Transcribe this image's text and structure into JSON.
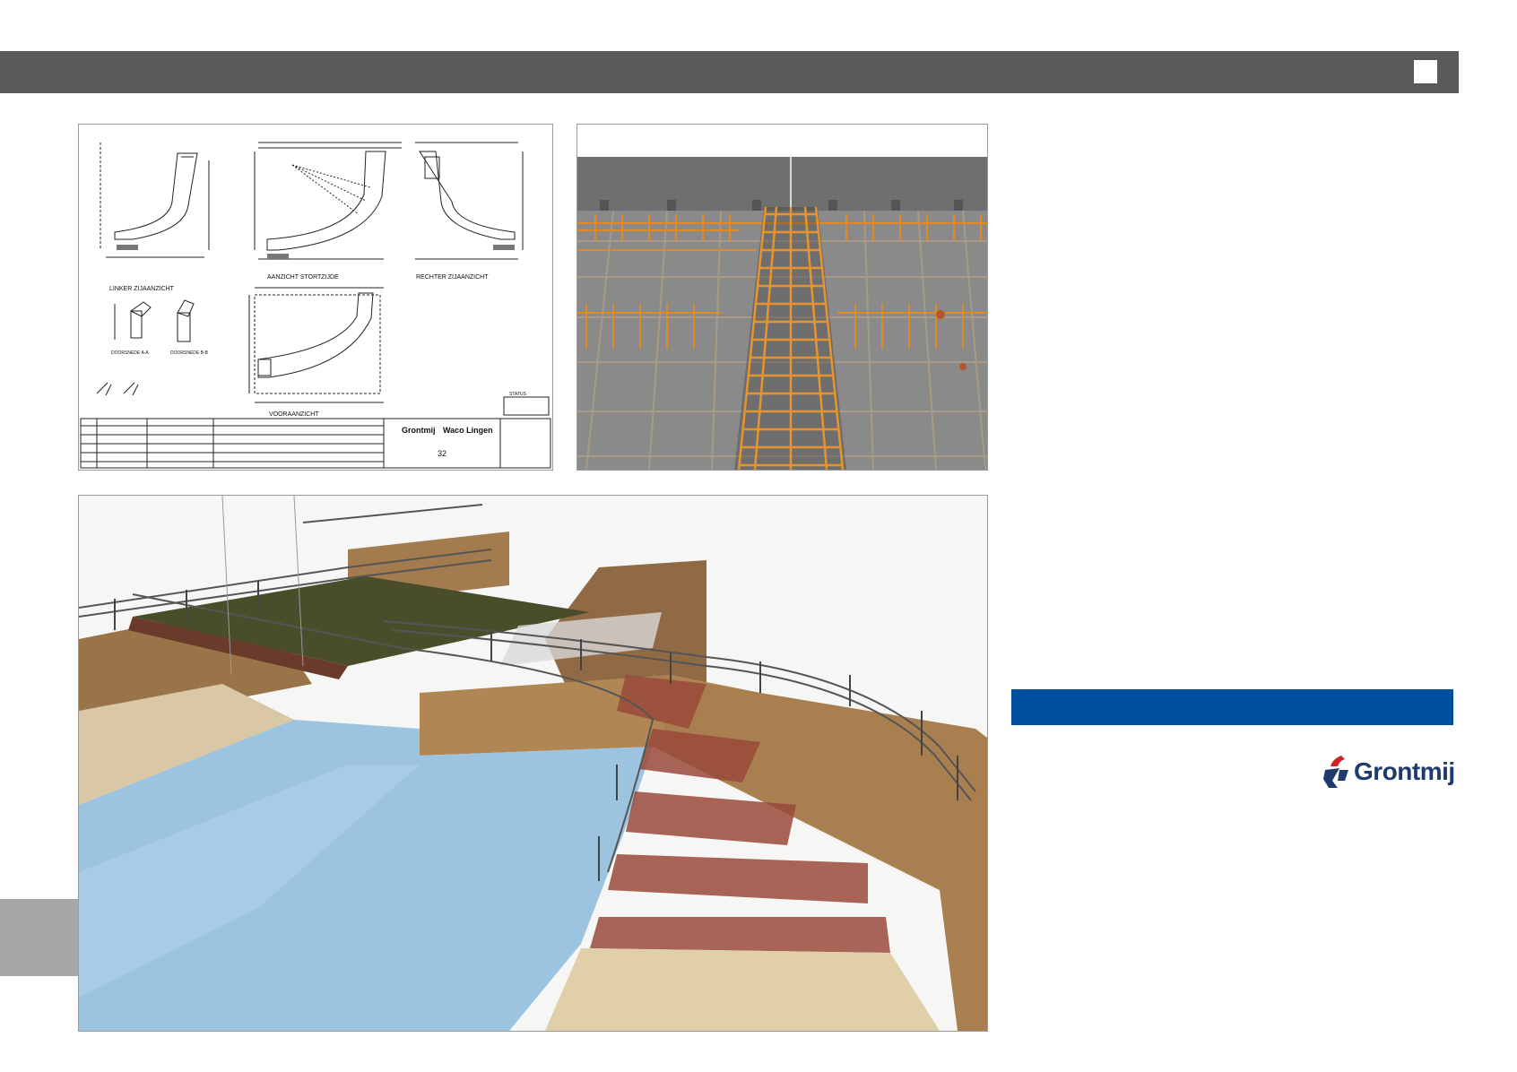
{
  "header": {
    "square_icon": "white-square"
  },
  "drawing": {
    "view_left": "LINKER ZIJAANZICHT",
    "view_front": "AANZICHT STORTZIJDE",
    "view_right": "RECHTER ZIJAANZICHT",
    "view_bottom": "VOORAANZICHT",
    "section_a": "DOORSNEDE A-A",
    "section_b": "DOORSNEDE B-B",
    "status_label": "STATUS",
    "titleblock_logo_1": "Grontmij",
    "titleblock_logo_2": "Waco Lingen",
    "sheet_number": "32"
  },
  "logo": {
    "text": "Grontmij",
    "icon": "grontmij-logo-icon"
  },
  "colors": {
    "topbar": "#5a5a5a",
    "accent_blue": "#0050a0",
    "side_block": "#a7a7aa",
    "rebar_orange": "#e38a1e",
    "water_blue": "#9cc3e0",
    "brick": "#b08655"
  }
}
